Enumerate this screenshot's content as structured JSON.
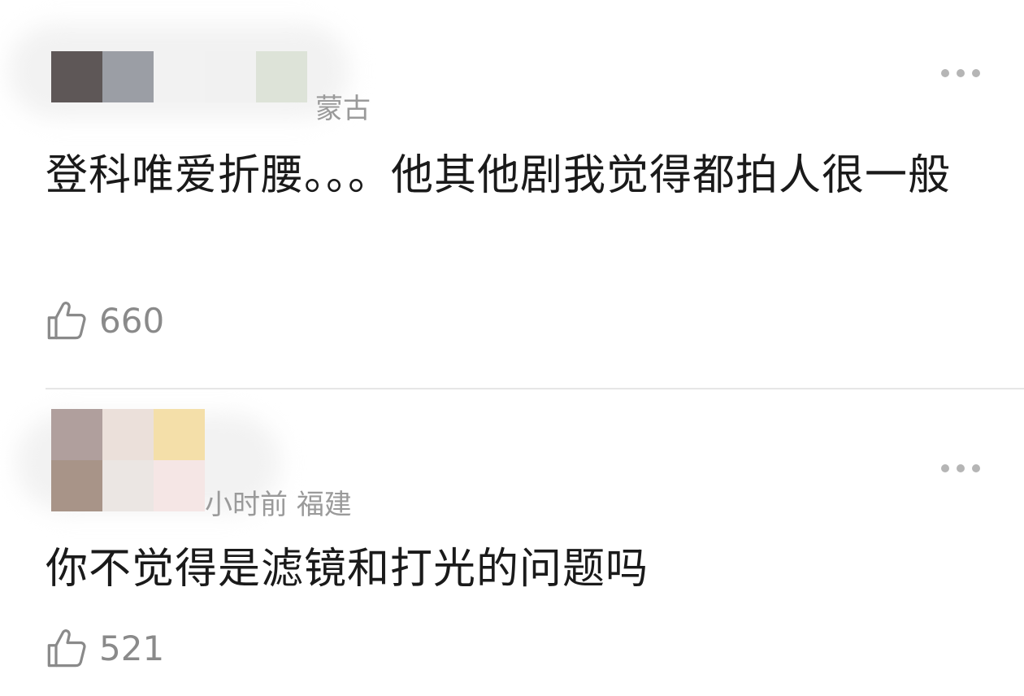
{
  "comments": [
    {
      "location_partial": "蒙古",
      "text": "登科唯爱折腰。。。他其他剧我觉得都拍人很一般",
      "likes": "660",
      "mosaic_colors": [
        "#5e5757",
        "#9b9ea5",
        "#f2f2f2",
        "#f1f1f1",
        "#dde3d8"
      ]
    },
    {
      "time_partial": "小时前",
      "location": "福建",
      "text": "你不觉得是滤镜和打光的问题吗",
      "likes": "521",
      "mosaic_colors": [
        "#b09f9d",
        "#ebe0da",
        "#f4dfa9",
        "#a89488",
        "#ebe6e3",
        "#f5e6e5"
      ]
    }
  ],
  "icons": {
    "like": "thumbs-up-icon",
    "more": "more-dots-icon"
  }
}
